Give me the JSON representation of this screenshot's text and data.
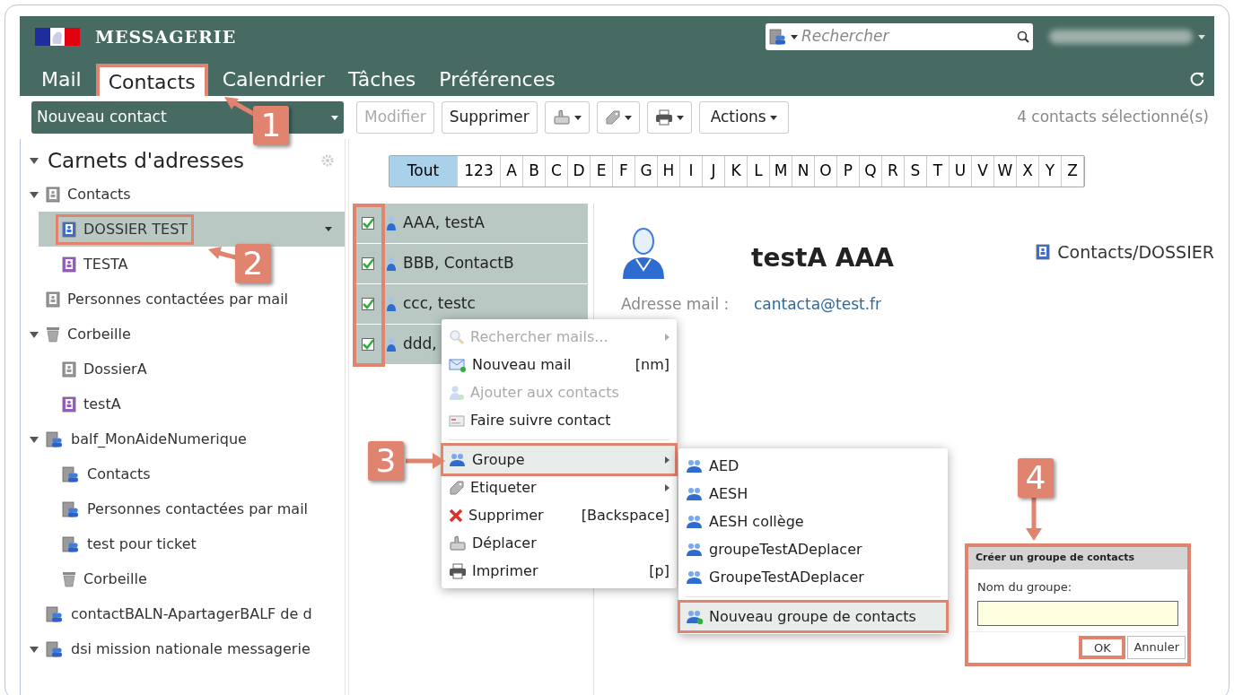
{
  "header": {
    "title": "MESSAGERIE",
    "search": {
      "placeholder": "Rechercher"
    }
  },
  "tabs": [
    {
      "label": "Mail",
      "selected": false,
      "highlighted": false
    },
    {
      "label": "Contacts",
      "selected": true,
      "highlighted": true
    },
    {
      "label": "Calendrier",
      "selected": false,
      "highlighted": false
    },
    {
      "label": "Tâches",
      "selected": false,
      "highlighted": false
    },
    {
      "label": "Préférences",
      "selected": false,
      "highlighted": false
    }
  ],
  "toolbar": {
    "new_contact": "Nouveau contact",
    "buttons": [
      {
        "kind": "text",
        "label": "Modifier",
        "disabled": true
      },
      {
        "kind": "text",
        "label": "Supprimer",
        "disabled": false
      },
      {
        "kind": "move",
        "disabled": false
      },
      {
        "kind": "tag",
        "disabled": false
      },
      {
        "kind": "print",
        "disabled": false
      },
      {
        "kind": "menu",
        "label": "Actions",
        "disabled": false
      }
    ],
    "status": "4 contacts sélectionné(s)"
  },
  "sidebar": {
    "title": "Carnets d'adresses",
    "tree": [
      {
        "label": "Contacts",
        "kind": "book",
        "selected": false,
        "highlighted": false,
        "expanded": true,
        "children": [
          {
            "label": "DOSSIER TEST",
            "kind": "book-blue",
            "selected": true,
            "highlighted": true
          },
          {
            "label": "TESTA",
            "kind": "book-purple",
            "selected": false,
            "highlighted": false
          }
        ]
      },
      {
        "label": "Personnes contactées par mail",
        "kind": "recent",
        "selected": false,
        "highlighted": false
      },
      {
        "label": "Corbeille",
        "kind": "trash",
        "selected": false,
        "highlighted": false,
        "expanded": true,
        "children": [
          {
            "label": "DossierA",
            "kind": "book",
            "selected": false,
            "highlighted": false
          },
          {
            "label": "testA",
            "kind": "book-purple",
            "selected": false,
            "highlighted": false
          }
        ]
      },
      {
        "label": "balf_MonAideNumerique",
        "kind": "shared",
        "selected": false,
        "highlighted": false,
        "expanded": true,
        "children": [
          {
            "label": "Contacts",
            "kind": "shared",
            "selected": false,
            "highlighted": false
          },
          {
            "label": "Personnes contactées par mail",
            "kind": "shared",
            "selected": false,
            "highlighted": false
          },
          {
            "label": "test pour ticket",
            "kind": "shared",
            "selected": false,
            "highlighted": false
          },
          {
            "label": "Corbeille",
            "kind": "trash",
            "selected": false,
            "highlighted": false
          }
        ]
      },
      {
        "label": "contactBALN-ApartagerBALF de d",
        "kind": "shared",
        "selected": false,
        "highlighted": false
      },
      {
        "label": "dsi mission nationale messagerie",
        "kind": "shared",
        "selected": false,
        "highlighted": false,
        "expanded": true
      }
    ]
  },
  "alphabet": [
    {
      "label": "Tout",
      "selected": true
    },
    {
      "label": "123",
      "selected": false
    },
    {
      "label": "A",
      "selected": false
    },
    {
      "label": "B",
      "selected": false
    },
    {
      "label": "C",
      "selected": false
    },
    {
      "label": "D",
      "selected": false
    },
    {
      "label": "E",
      "selected": false
    },
    {
      "label": "F",
      "selected": false
    },
    {
      "label": "G",
      "selected": false
    },
    {
      "label": "H",
      "selected": false
    },
    {
      "label": "I",
      "selected": false
    },
    {
      "label": "J",
      "selected": false
    },
    {
      "label": "K",
      "selected": false
    },
    {
      "label": "L",
      "selected": false
    },
    {
      "label": "M",
      "selected": false
    },
    {
      "label": "N",
      "selected": false
    },
    {
      "label": "O",
      "selected": false
    },
    {
      "label": "P",
      "selected": false
    },
    {
      "label": "Q",
      "selected": false
    },
    {
      "label": "R",
      "selected": false
    },
    {
      "label": "S",
      "selected": false
    },
    {
      "label": "T",
      "selected": false
    },
    {
      "label": "U",
      "selected": false
    },
    {
      "label": "V",
      "selected": false
    },
    {
      "label": "W",
      "selected": false
    },
    {
      "label": "X",
      "selected": false
    },
    {
      "label": "Y",
      "selected": false
    },
    {
      "label": "Z",
      "selected": false
    }
  ],
  "contacts": {
    "checkbox_column_highlighted": true,
    "rows": [
      {
        "name": "AAA, testA",
        "checked": true,
        "selected": true
      },
      {
        "name": "BBB, ContactB",
        "checked": true,
        "selected": true
      },
      {
        "name": "ccc, testc",
        "checked": true,
        "selected": true
      },
      {
        "name": "ddd,",
        "checked": true,
        "selected": true
      }
    ]
  },
  "detail": {
    "name": "testA AAA",
    "location": "Contacts/DOSSIER",
    "fields": [
      {
        "label": "Adresse mail :",
        "value": "cantacta@test.fr"
      }
    ]
  },
  "context_menu": {
    "items": [
      {
        "kind": "search",
        "label": "Rechercher mails...",
        "disabled": true,
        "submenu": true,
        "highlighted": false
      },
      {
        "kind": "mail",
        "label": "Nouveau mail",
        "shortcut": "[nm]",
        "disabled": false,
        "submenu": false,
        "highlighted": false
      },
      {
        "kind": "add-contact",
        "label": "Ajouter aux contacts",
        "disabled": true,
        "submenu": false,
        "highlighted": false
      },
      {
        "kind": "card",
        "label": "Faire suivre contact",
        "disabled": false,
        "submenu": false,
        "highlighted": false
      },
      {
        "kind": "separator"
      },
      {
        "kind": "group",
        "label": "Groupe",
        "disabled": false,
        "submenu": true,
        "highlighted": true
      },
      {
        "kind": "tag",
        "label": "Etiqueter",
        "disabled": false,
        "submenu": true,
        "highlighted": false
      },
      {
        "kind": "delete",
        "label": "Supprimer",
        "shortcut": "[Backspace]",
        "disabled": false,
        "submenu": false,
        "highlighted": false
      },
      {
        "kind": "move",
        "label": "Déplacer",
        "disabled": false,
        "submenu": false,
        "highlighted": false
      },
      {
        "kind": "print",
        "label": "Imprimer",
        "shortcut": "[p]",
        "disabled": false,
        "submenu": false,
        "highlighted": false
      }
    ]
  },
  "group_submenu": {
    "items": [
      {
        "kind": "group",
        "label": "AED",
        "highlighted": false
      },
      {
        "kind": "group",
        "label": "AESH",
        "highlighted": false
      },
      {
        "kind": "group",
        "label": "AESH collège",
        "highlighted": false
      },
      {
        "kind": "group",
        "label": "groupeTestADeplacer",
        "highlighted": false
      },
      {
        "kind": "group",
        "label": "GroupeTestADeplacer",
        "highlighted": false
      },
      {
        "kind": "separator"
      },
      {
        "kind": "group-add",
        "label": "Nouveau groupe de contacts",
        "highlighted": true
      }
    ]
  },
  "dialog": {
    "title": "Créer un groupe de contacts",
    "label": "Nom du groupe:",
    "highlighted": true,
    "buttons": [
      {
        "label": "OK",
        "highlighted": true
      },
      {
        "label": "Annuler",
        "highlighted": false
      }
    ]
  },
  "annotations": [
    {
      "number": "1"
    },
    {
      "number": "2"
    },
    {
      "number": "3"
    },
    {
      "number": "4"
    }
  ]
}
